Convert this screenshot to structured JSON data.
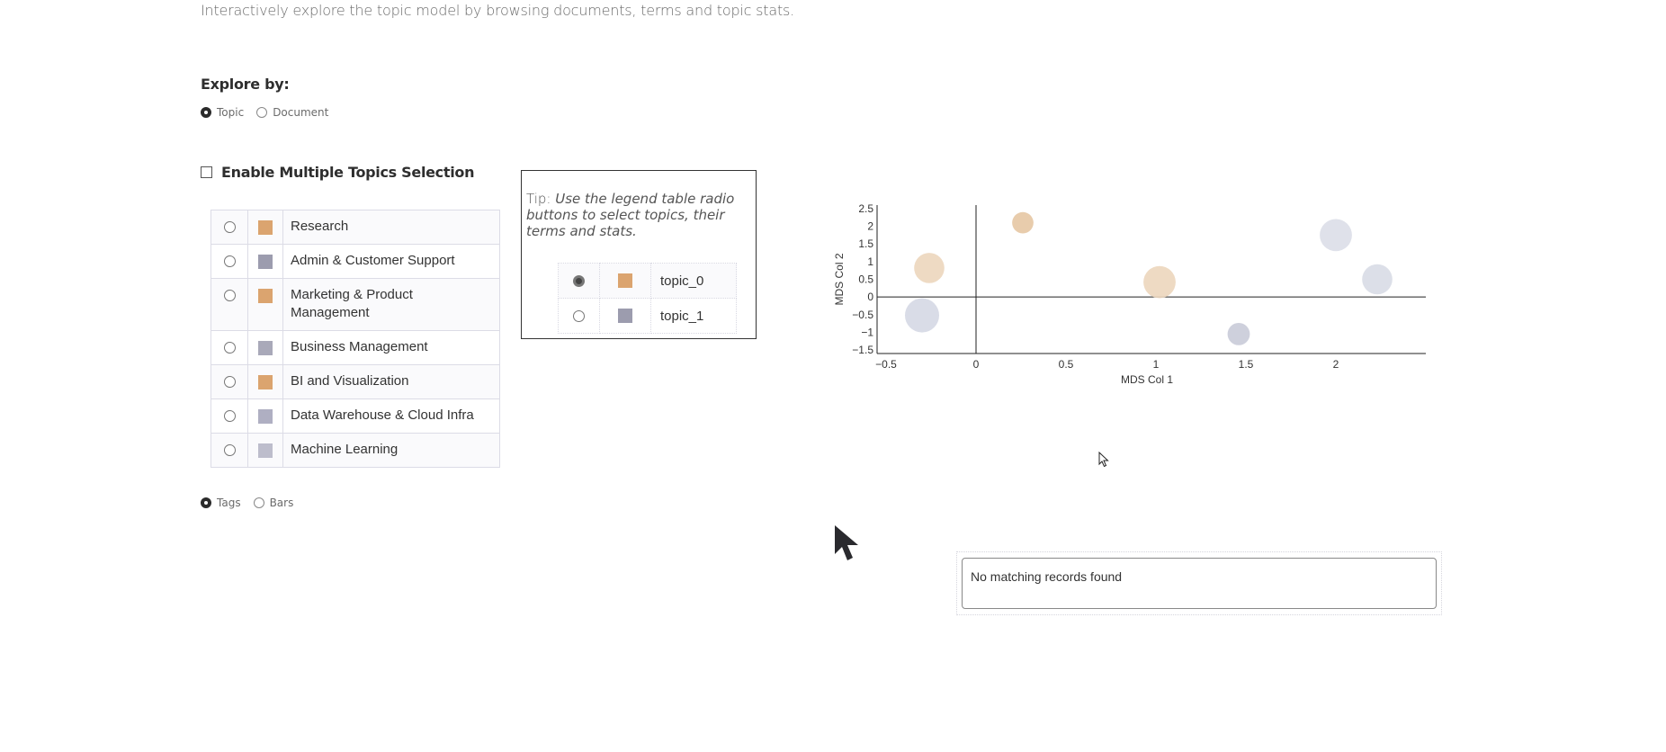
{
  "header": {
    "subtitle": "Interactively explore the topic model by browsing documents, terms and topic stats."
  },
  "explore": {
    "label": "Explore by:",
    "options": [
      {
        "label": "Topic",
        "selected": true
      },
      {
        "label": "Document",
        "selected": false
      }
    ]
  },
  "multi_select": {
    "label": "Enable Multiple Topics Selection",
    "checked": false
  },
  "topics": [
    {
      "label": "Research",
      "color": "#dba46f",
      "selected": false
    },
    {
      "label": "Admin & Customer Support",
      "color": "#9c9cae",
      "selected": false
    },
    {
      "label": "Marketing & Product Management",
      "color": "#dba46f",
      "selected": false
    },
    {
      "label": "Business Management",
      "color": "#a9a9b9",
      "selected": false
    },
    {
      "label": "BI and Visualization",
      "color": "#dba46f",
      "selected": false
    },
    {
      "label": "Data Warehouse & Cloud Infra",
      "color": "#afafc2",
      "selected": false
    },
    {
      "label": "Machine Learning",
      "color": "#bdbdcc",
      "selected": false
    }
  ],
  "view_mode": {
    "options": [
      {
        "label": "Tags",
        "selected": true
      },
      {
        "label": "Bars",
        "selected": false
      }
    ]
  },
  "tip": {
    "prefix": "Tip:",
    "text": "Use the legend table radio buttons to select topics, their terms and stats.",
    "example_rows": [
      {
        "label": "topic_0",
        "color": "#dba46f",
        "selected": true
      },
      {
        "label": "topic_1",
        "color": "#9c9cae",
        "selected": false
      }
    ]
  },
  "records": {
    "empty_message": "No matching records found"
  },
  "chart_data": {
    "type": "scatter",
    "title": "",
    "xlabel": "MDS Col 1",
    "ylabel": "MDS Col 2",
    "xlim": [
      -0.55,
      2.5
    ],
    "ylim": [
      -1.6,
      2.6
    ],
    "xticks": [
      "-0.5",
      "0",
      "0.5",
      "1",
      "1.5",
      "2"
    ],
    "xtick_values": [
      -0.5,
      0,
      0.5,
      1,
      1.5,
      2
    ],
    "yticks": [
      "2.5",
      "2",
      "1.5",
      "1",
      "0.5",
      "0",
      "-0.5",
      "-1",
      "-1.5"
    ],
    "ytick_values": [
      2.5,
      2,
      1.5,
      1,
      0.5,
      0,
      -0.5,
      -1,
      -1.5
    ],
    "grid": false,
    "zero_lines": true,
    "points": [
      {
        "x": 0.26,
        "y": 2.1,
        "size": 0.35,
        "color": "#e6c7a3"
      },
      {
        "x": -0.26,
        "y": 0.82,
        "size": 0.8,
        "color": "#ecd6bd"
      },
      {
        "x": -0.3,
        "y": -0.52,
        "size": 1.0,
        "color": "#d5d8e4"
      },
      {
        "x": 1.02,
        "y": 0.42,
        "size": 0.9,
        "color": "#ecd6bd"
      },
      {
        "x": 2.0,
        "y": 1.75,
        "size": 0.9,
        "color": "#dcdee8"
      },
      {
        "x": 2.23,
        "y": 0.5,
        "size": 0.8,
        "color": "#d8dbe5"
      },
      {
        "x": 1.46,
        "y": -1.05,
        "size": 0.4,
        "color": "#c9cbd8"
      }
    ]
  }
}
